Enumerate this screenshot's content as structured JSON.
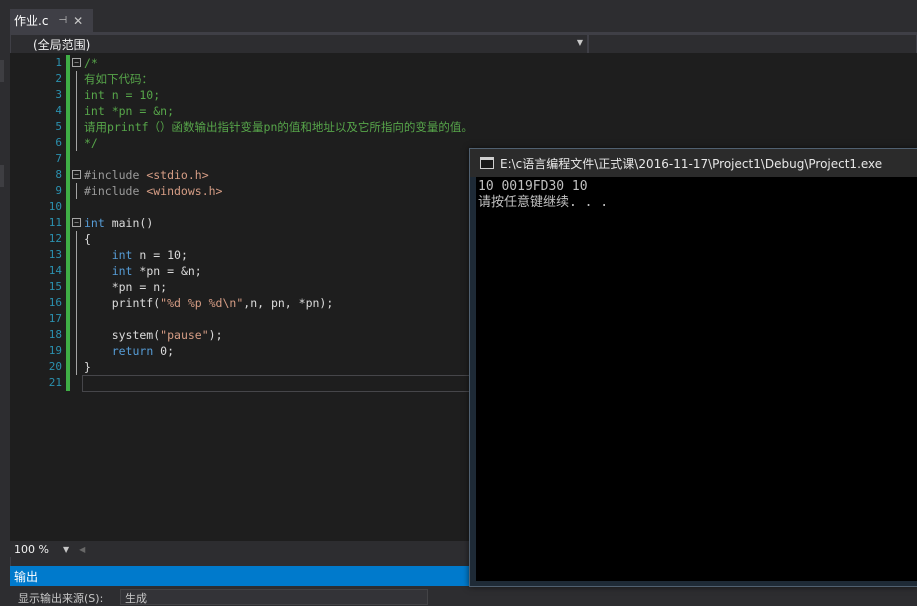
{
  "tab": {
    "title": "作业.c",
    "pin_icon": "⊣",
    "close_icon": "✕"
  },
  "navbar": {
    "scope": "(全局范围)"
  },
  "editor": {
    "line_numbers": [
      "1",
      "2",
      "3",
      "4",
      "5",
      "6",
      "7",
      "8",
      "9",
      "10",
      "11",
      "12",
      "13",
      "14",
      "15",
      "16",
      "17",
      "18",
      "19",
      "20",
      "21"
    ],
    "lines": [
      "/*",
      "有如下代码：",
      "int n = 10;",
      "int *pn = &n;",
      "请用printf（）函数输出指针变量pn的值和地址以及它所指向的变量的值。",
      "*/",
      "",
      "#include <stdio.h>",
      "#include <windows.h>",
      "",
      "int main()",
      "{",
      "    int n = 10;",
      "    int *pn = &n;",
      "    *pn = n;",
      "    printf(\"%d %p %d\\n\",n, pn, *pn);",
      "",
      "    system(\"pause\");",
      "    return 0;",
      "}",
      ""
    ],
    "zoom": "100 %"
  },
  "output": {
    "header": "输出",
    "source_label": "显示输出来源(S):",
    "source_value": "生成"
  },
  "console": {
    "title": "E:\\c语言编程文件\\正式课\\2016-11-17\\Project1\\Debug\\Project1.exe",
    "lines": [
      "10 0019FD30 10",
      "请按任意键继续. . ."
    ]
  }
}
